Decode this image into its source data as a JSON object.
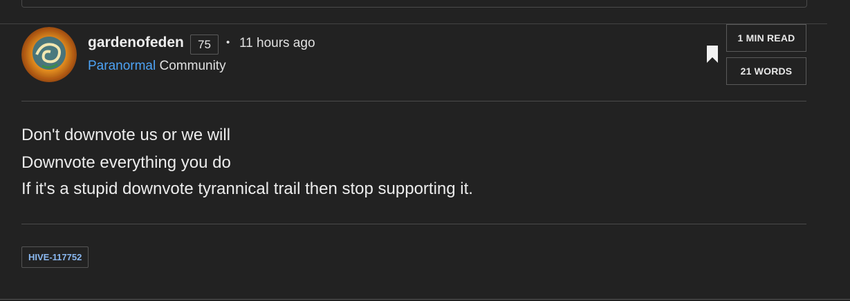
{
  "post": {
    "author": "gardenofeden",
    "reputation": "75",
    "separator": "•",
    "time_ago": "11 hours ago",
    "community_name": "Paranormal",
    "community_suffix": "Community",
    "stats": {
      "read_time": "1 MIN READ",
      "word_count": "21 WORDS"
    },
    "body_lines": [
      "Don't downvote us or we will",
      "Downvote everything you do",
      "If it's a stupid downvote tyrannical trail then stop supporting it."
    ],
    "tags": [
      "HIVE-117752"
    ]
  },
  "icons": {
    "bookmark": "bookmark-icon",
    "avatar": "avatar-image"
  },
  "colors": {
    "background": "#222222",
    "link": "#4da3f5",
    "tag_text": "#8ab8f0",
    "text": "#e8e8e8",
    "border": "#4a4a4a"
  }
}
